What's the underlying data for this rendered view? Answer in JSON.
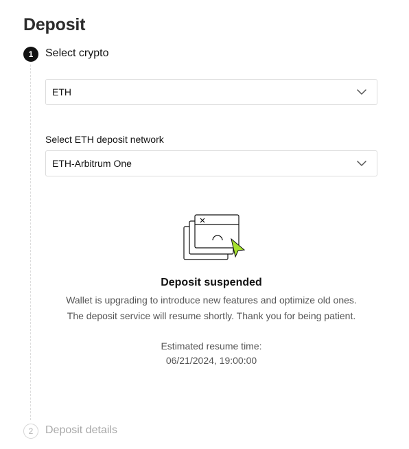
{
  "page": {
    "title": "Deposit"
  },
  "steps": [
    {
      "number": "1",
      "label": "Select crypto",
      "state": "active"
    },
    {
      "number": "2",
      "label": "Deposit details",
      "state": "inactive"
    }
  ],
  "crypto_select": {
    "value": "ETH",
    "icon": "chevron-down-icon"
  },
  "network_select": {
    "label": "Select ETH deposit network",
    "value": "ETH-Arbitrum One",
    "icon": "chevron-down-icon"
  },
  "suspended": {
    "illustration": "window-suspended-illustration",
    "title": "Deposit suspended",
    "line1": "Wallet is upgrading to introduce new features and optimize old ones.",
    "line2": "The deposit service will resume shortly. Thank you for being patient.",
    "resume_label": "Estimated resume time:",
    "resume_time": "06/21/2024, 19:00:00"
  },
  "colors": {
    "accent": "#a6e22e",
    "text": "#121212",
    "muted": "#555555",
    "border": "#dcdcdc"
  }
}
